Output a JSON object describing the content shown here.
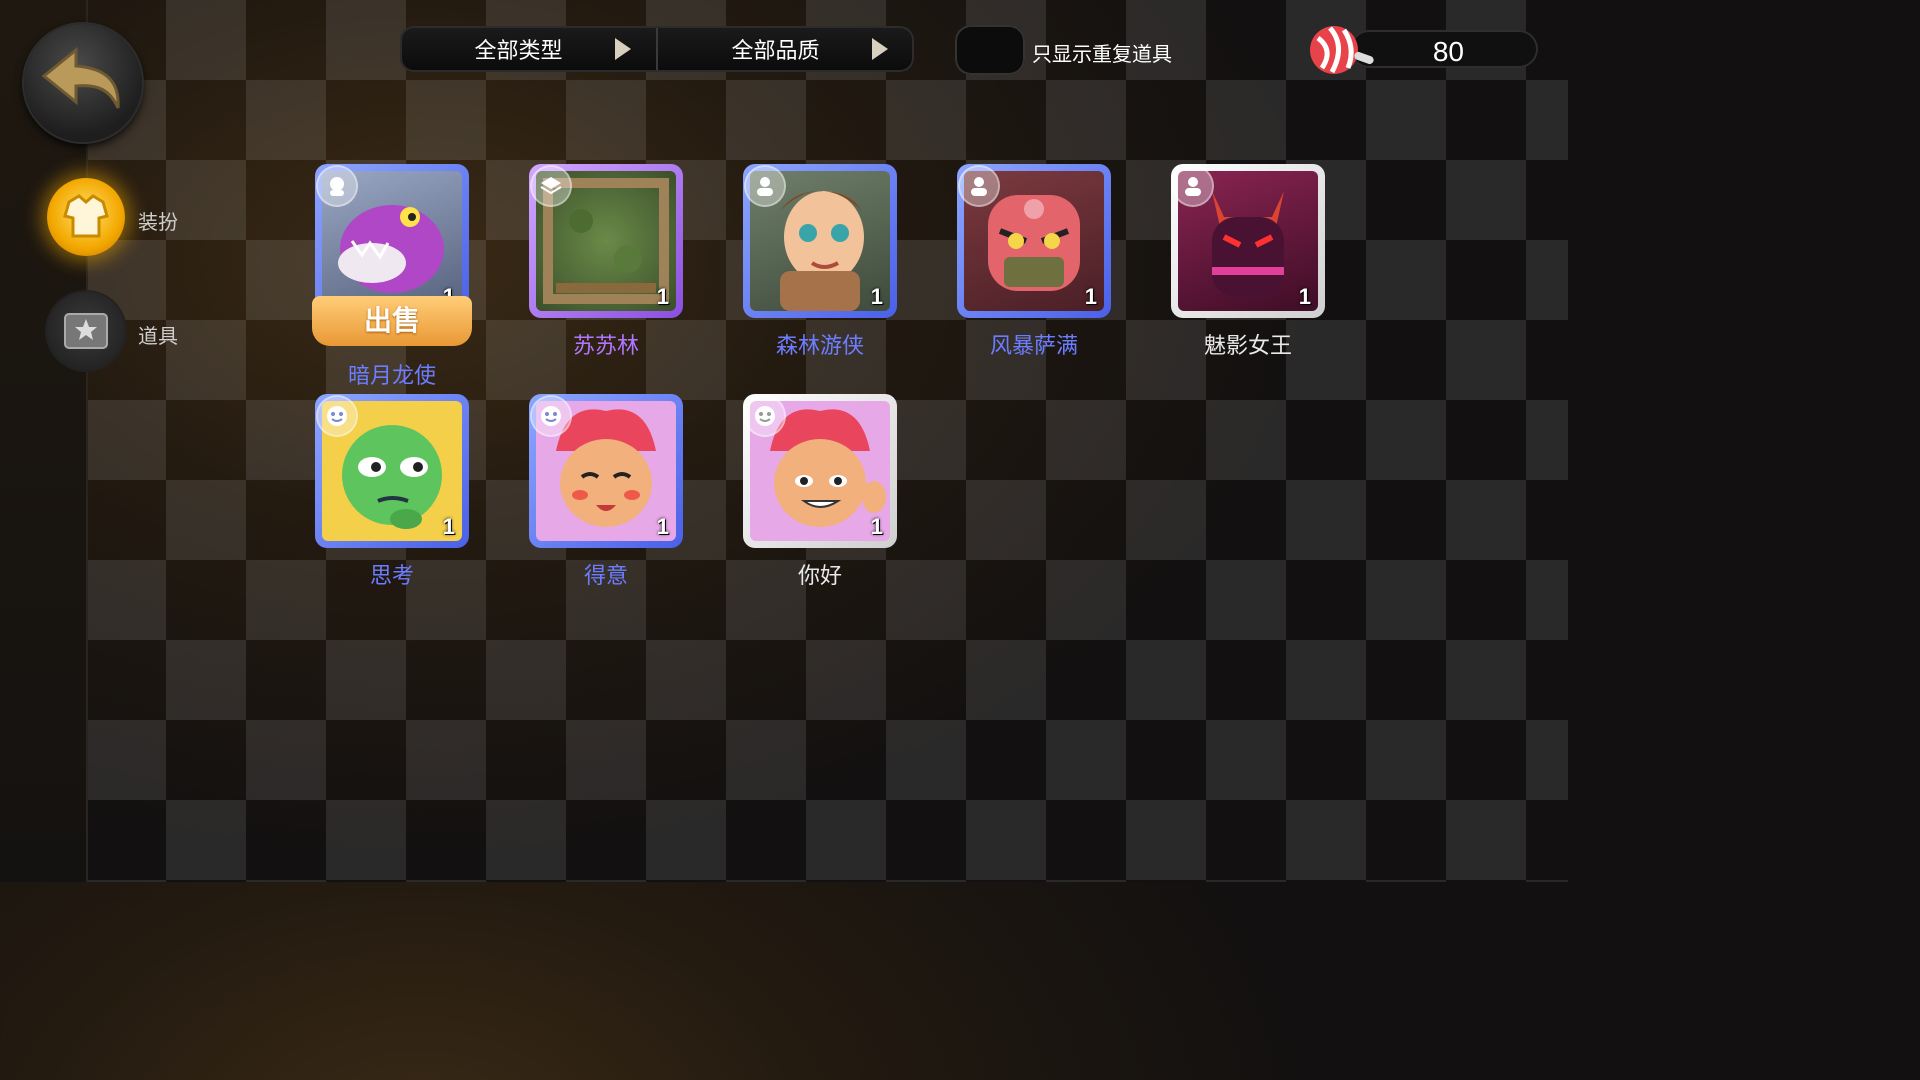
{
  "nav": {
    "back_label": "",
    "items": [
      {
        "label": "装扮",
        "icon": "outfit-icon",
        "active": true
      },
      {
        "label": "道具",
        "icon": "item-icon",
        "active": false
      }
    ]
  },
  "filters": {
    "type_label": "全部类型",
    "quality_label": "全部品质",
    "toggle_label": "只显示重复道具"
  },
  "currency": {
    "icon": "candy-icon",
    "amount": "80"
  },
  "sell_button_label": "出售",
  "colors": {
    "blue": "#4a60e8",
    "purple": "#8a4fe0",
    "white": "#e9e9e9",
    "accent": "#f3a800"
  },
  "items": [
    {
      "name": "暗月龙使",
      "count": "1",
      "rarity": "blue",
      "badge": "portrait-icon"
    },
    {
      "name": "苏苏林",
      "count": "1",
      "rarity": "purple",
      "badge": "board-icon"
    },
    {
      "name": "森林游侠",
      "count": "1",
      "rarity": "blue",
      "badge": "avatar-icon"
    },
    {
      "name": "风暴萨满",
      "count": "1",
      "rarity": "blue",
      "badge": "avatar-icon"
    },
    {
      "name": "魅影女王",
      "count": "1",
      "rarity": "white",
      "badge": "avatar-icon"
    },
    {
      "name": "思考",
      "count": "1",
      "rarity": "blue",
      "badge": "emote-icon"
    },
    {
      "name": "得意",
      "count": "1",
      "rarity": "blue",
      "badge": "emote-icon"
    },
    {
      "name": "你好",
      "count": "1",
      "rarity": "white",
      "badge": "emote-icon"
    }
  ]
}
